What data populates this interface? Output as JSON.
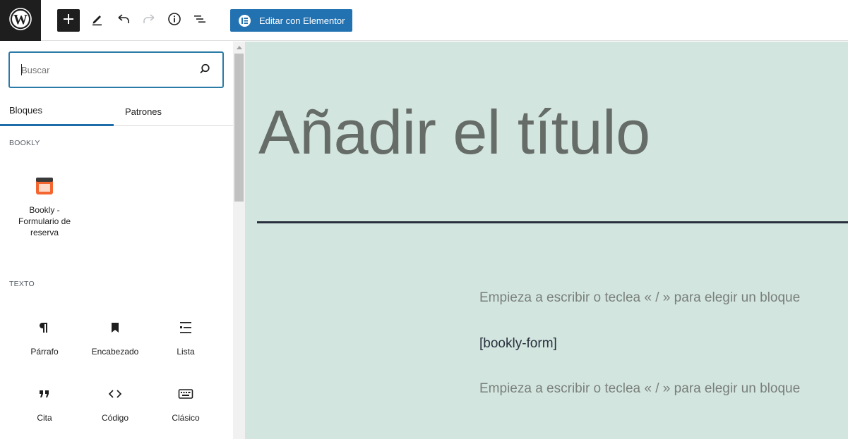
{
  "toolbar": {
    "elementor_label": "Editar con Elementor",
    "icons": [
      "wordpress-icon",
      "plus-icon",
      "pencil-icon",
      "undo-icon",
      "redo-icon",
      "info-icon",
      "list-view-icon",
      "elementor-icon"
    ]
  },
  "inserter": {
    "search_placeholder": "Buscar",
    "tabs": [
      "Bloques",
      "Patrones"
    ],
    "categories": [
      {
        "label": "BOOKLY",
        "blocks": [
          {
            "label": "Bookly - Formulario de reserva",
            "icon": "bookly-icon"
          }
        ]
      },
      {
        "label": "TEXTO",
        "blocks": [
          {
            "label": "Párrafo",
            "icon": "paragraph-icon"
          },
          {
            "label": "Encabezado",
            "icon": "bookmark-icon"
          },
          {
            "label": "Lista",
            "icon": "list-icon"
          },
          {
            "label": "Cita",
            "icon": "quote-icon"
          },
          {
            "label": "Código",
            "icon": "code-icon"
          },
          {
            "label": "Clásico",
            "icon": "keyboard-icon"
          }
        ]
      }
    ]
  },
  "editor": {
    "title_placeholder": "Añadir el título",
    "paragraph_hint_1": "Empieza a escribir o teclea « / » para elegir un bloque",
    "shortcode": "[bookly-form]",
    "paragraph_hint_2": "Empieza a escribir o teclea « / » para elegir un bloque"
  },
  "colors": {
    "canvas_bg": "#d3e5df",
    "accent": "#2271b1",
    "toolbar_dark": "#1e1e1e",
    "divider": "#28303d"
  }
}
